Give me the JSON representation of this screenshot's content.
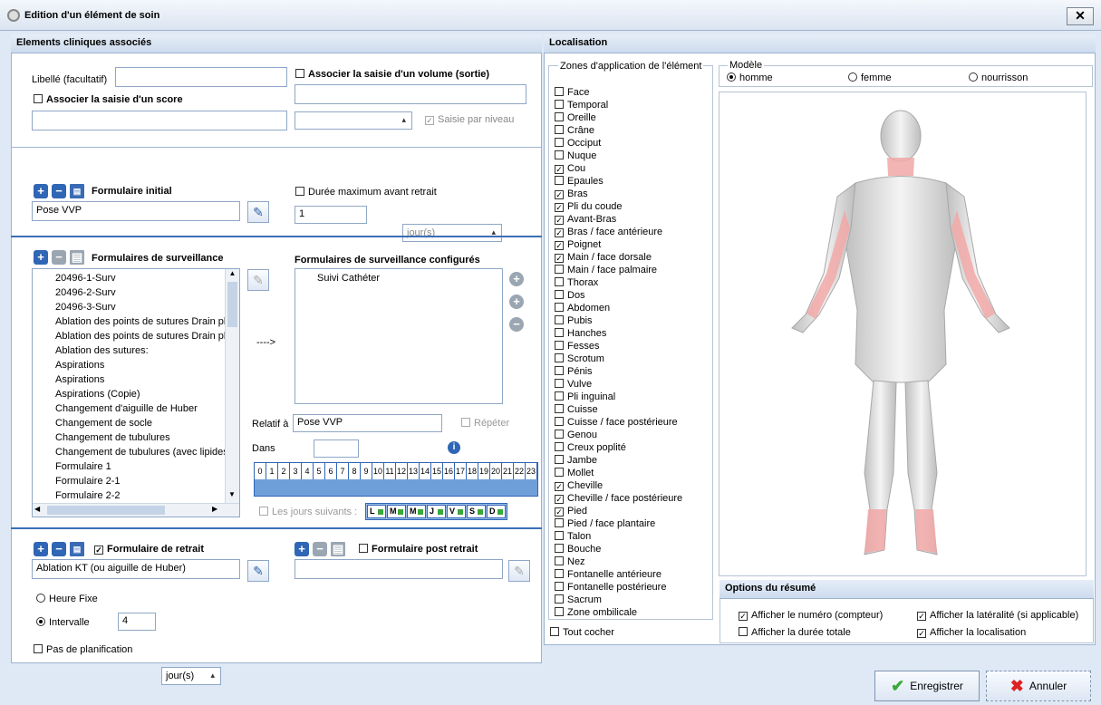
{
  "window": {
    "title": "Edition d'un élément de soin",
    "close": "✕"
  },
  "clinical": {
    "header": "Elements cliniques associés",
    "libelle_label": "Libellé (facultatif)",
    "volume_label": "Associer la saisie d'un volume (sortie)",
    "score_label": "Associer la saisie d'un score",
    "saisie_niveau": "Saisie par niveau"
  },
  "initial": {
    "title": "Formulaire initial",
    "value": "Pose VVP",
    "duree_label": "Durée maximum avant retrait",
    "duree_value": "1",
    "duree_unit": "jour(s)"
  },
  "surveillance": {
    "title": "Formulaires de surveillance",
    "configured_title": "Formulaires de surveillance configurés",
    "items": [
      "20496-1-Surv",
      "20496-2-Surv",
      "20496-3-Surv",
      "Ablation des points de sutures Drain pl",
      "Ablation des points de sutures Drain pl",
      "Ablation des sutures:",
      "Aspirations",
      "Aspirations",
      "Aspirations  (Copie)",
      "Changement d'aiguille de Huber",
      "Changement de socle",
      "Changement de tubulures",
      "Changement de tubulures (avec lipides",
      "Formulaire 1",
      "Formulaire 2-1",
      "Formulaire 2-2"
    ],
    "configured_items": [
      "Suivi Cathéter"
    ],
    "arrow": "---->",
    "relatif_label": "Relatif à",
    "relatif_value": "Pose VVP",
    "repeter": "Répéter",
    "dans_label": "Dans",
    "hours": [
      "0",
      "1",
      "2",
      "3",
      "4",
      "5",
      "6",
      "7",
      "8",
      "9",
      "10",
      "11",
      "12",
      "13",
      "14",
      "15",
      "16",
      "17",
      "18",
      "19",
      "20",
      "21",
      "22",
      "23"
    ],
    "jours_label": "Les jours suivants :",
    "days": [
      "L",
      "M",
      "M",
      "J",
      "V",
      "S",
      "D"
    ]
  },
  "retrait": {
    "title": "Formulaire de retrait",
    "value": "Ablation KT (ou aiguille de Huber)",
    "post_title": "Formulaire post retrait",
    "heure_fixe": "Heure Fixe",
    "intervalle": "Intervalle",
    "interval_value": "4",
    "interval_unit": "jour(s)",
    "pas_planif": "Pas de planification"
  },
  "localisation": {
    "header": "Localisation",
    "zones_title": "Zones d'application de l'élément",
    "zones": [
      [
        "Face",
        false
      ],
      [
        "Temporal",
        false
      ],
      [
        "Oreille",
        false
      ],
      [
        "Crâne",
        false
      ],
      [
        "Occiput",
        false
      ],
      [
        "Nuque",
        false
      ],
      [
        "Cou",
        true
      ],
      [
        "Epaules",
        false
      ],
      [
        "Bras",
        true
      ],
      [
        "Pli du coude",
        true
      ],
      [
        "Avant-Bras",
        true
      ],
      [
        "Bras / face antérieure",
        true
      ],
      [
        "Poignet",
        true
      ],
      [
        "Main / face dorsale",
        true
      ],
      [
        "Main / face palmaire",
        false
      ],
      [
        "Thorax",
        false
      ],
      [
        "Dos",
        false
      ],
      [
        "Abdomen",
        false
      ],
      [
        "Pubis",
        false
      ],
      [
        "Hanches",
        false
      ],
      [
        "Fesses",
        false
      ],
      [
        "Scrotum",
        false
      ],
      [
        "Pénis",
        false
      ],
      [
        "Vulve",
        false
      ],
      [
        "Pli inguinal",
        false
      ],
      [
        "Cuisse",
        false
      ],
      [
        "Cuisse / face postérieure",
        false
      ],
      [
        "Genou",
        false
      ],
      [
        "Creux poplité",
        false
      ],
      [
        "Jambe",
        false
      ],
      [
        "Mollet",
        false
      ],
      [
        "Cheville",
        true
      ],
      [
        "Cheville / face postérieure",
        true
      ],
      [
        "Pied",
        true
      ],
      [
        "Pied / face plantaire",
        false
      ],
      [
        "Talon",
        false
      ],
      [
        "Bouche",
        false
      ],
      [
        "Nez",
        false
      ],
      [
        "Fontanelle antérieure",
        false
      ],
      [
        "Fontanelle postérieure",
        false
      ],
      [
        "Sacrum",
        false
      ],
      [
        "Zone ombilicale",
        false
      ]
    ],
    "tout_cocher": "Tout cocher",
    "modele_label": "Modèle",
    "models": [
      "homme",
      "femme",
      "nourrisson"
    ],
    "selected_model": "homme",
    "highlight_color": "#f2a8a8"
  },
  "options": {
    "header": "Options du résumé",
    "numero": "Afficher le numéro (compteur)",
    "lateralite": "Afficher la latéralité (si applicable)",
    "duree": "Afficher la durée totale",
    "localisation": "Afficher la localisation"
  },
  "footer": {
    "save": "Enregistrer",
    "cancel": "Annuler"
  }
}
